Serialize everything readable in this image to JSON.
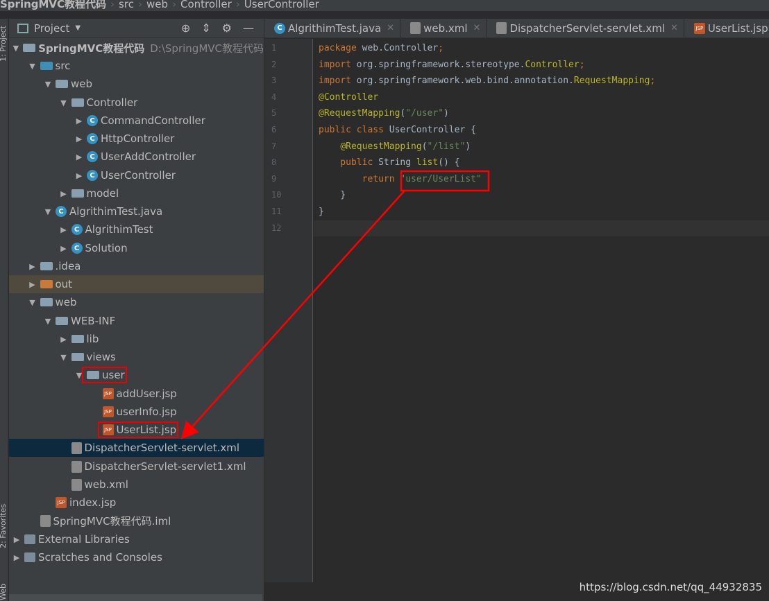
{
  "breadcrumb": [
    "SpringMVC教程代码",
    "src",
    "web",
    "Controller",
    "UserController"
  ],
  "side_stripe": {
    "project": "1: Project",
    "favorites": "2: Favorites",
    "web": "Web"
  },
  "panel": {
    "title": "Project",
    "icons": [
      "locate-icon",
      "collapse-all-icon",
      "gear-icon",
      "minimize-icon"
    ]
  },
  "tree": [
    {
      "label": "SpringMVC教程代码",
      "extra": "D:\\SpringMVC教程代码",
      "level": 0,
      "state": "open",
      "icon": "module",
      "bold": true
    },
    {
      "label": "src",
      "level": 1,
      "state": "open",
      "icon": "src"
    },
    {
      "label": "web",
      "level": 2,
      "state": "open",
      "icon": "folder"
    },
    {
      "label": "Controller",
      "level": 3,
      "state": "open",
      "icon": "folder"
    },
    {
      "label": "CommandController",
      "level": 4,
      "state": "closed",
      "icon": "class"
    },
    {
      "label": "HttpController",
      "level": 4,
      "state": "closed",
      "icon": "class"
    },
    {
      "label": "UserAddController",
      "level": 4,
      "state": "closed",
      "icon": "class"
    },
    {
      "label": "UserController",
      "level": 4,
      "state": "closed",
      "icon": "class"
    },
    {
      "label": "model",
      "level": 3,
      "state": "closed",
      "icon": "folder"
    },
    {
      "label": "AlgrithimTest.java",
      "level": 2,
      "state": "open",
      "icon": "class"
    },
    {
      "label": "AlgrithimTest",
      "level": 3,
      "state": "closed",
      "icon": "class"
    },
    {
      "label": "Solution",
      "level": 3,
      "state": "closed",
      "icon": "class"
    },
    {
      "label": ".idea",
      "level": 1,
      "state": "closed",
      "icon": "folder"
    },
    {
      "label": "out",
      "level": 1,
      "state": "closed",
      "icon": "out"
    },
    {
      "label": "web",
      "level": 1,
      "state": "open",
      "icon": "folder"
    },
    {
      "label": "WEB-INF",
      "level": 2,
      "state": "open",
      "icon": "folder"
    },
    {
      "label": "lib",
      "level": 3,
      "state": "closed",
      "icon": "folder"
    },
    {
      "label": "views",
      "level": 3,
      "state": "open",
      "icon": "folder"
    },
    {
      "label": "user",
      "level": 4,
      "state": "open",
      "icon": "folder",
      "highlight": true
    },
    {
      "label": "addUser.jsp",
      "level": 5,
      "state": "leaf",
      "icon": "jsp"
    },
    {
      "label": "userInfo.jsp",
      "level": 5,
      "state": "leaf",
      "icon": "jsp"
    },
    {
      "label": "UserList.jsp",
      "level": 5,
      "state": "leaf",
      "icon": "jsp",
      "highlight": true
    },
    {
      "label": "DispatcherServlet-servlet.xml",
      "level": 3,
      "state": "leaf",
      "icon": "xml",
      "selected": true
    },
    {
      "label": "DispatcherServlet-servlet1.xml",
      "level": 3,
      "state": "leaf",
      "icon": "xml"
    },
    {
      "label": "web.xml",
      "level": 3,
      "state": "leaf",
      "icon": "xml"
    },
    {
      "label": "index.jsp",
      "level": 2,
      "state": "leaf",
      "icon": "jsp"
    },
    {
      "label": "SpringMVC教程代码.iml",
      "level": 1,
      "state": "leaf",
      "icon": "iml"
    },
    {
      "label": "External Libraries",
      "level": 0,
      "state": "closed",
      "icon": "lib"
    },
    {
      "label": "Scratches and Consoles",
      "level": 0,
      "state": "closed",
      "icon": "scratch"
    }
  ],
  "tabs": [
    {
      "label": "AlgrithimTest.java",
      "icon": "class"
    },
    {
      "label": "web.xml",
      "icon": "xml"
    },
    {
      "label": "DispatcherServlet-servlet.xml",
      "icon": "xml"
    },
    {
      "label": "UserList.jsp",
      "icon": "jsp"
    }
  ],
  "code": [
    [
      [
        "kw",
        "package "
      ],
      [
        "pl",
        "web.Controller"
      ],
      [
        "kw",
        ";"
      ]
    ],
    [
      [
        "kw",
        "import "
      ],
      [
        "pl",
        "org.springframework.stereotype."
      ],
      [
        "an",
        "Controller"
      ],
      [
        "kw",
        ";"
      ]
    ],
    [
      [
        "kw",
        "import "
      ],
      [
        "pl",
        "org.springframework.web.bind.annotation."
      ],
      [
        "an",
        "RequestMapping"
      ],
      [
        "kw",
        ";"
      ]
    ],
    [
      [
        "an",
        "@Controller"
      ]
    ],
    [
      [
        "an",
        "@RequestMapping"
      ],
      [
        "pl",
        "("
      ],
      [
        "str",
        "\"/user\""
      ],
      [
        "pl",
        ")"
      ]
    ],
    [
      [
        "kw",
        "public class "
      ],
      [
        "pl",
        "UserController {"
      ]
    ],
    [
      [
        "pl",
        "    "
      ],
      [
        "an",
        "@RequestMapping"
      ],
      [
        "pl",
        "("
      ],
      [
        "str",
        "\"/list\""
      ],
      [
        "pl",
        ")"
      ]
    ],
    [
      [
        "kw",
        "    public "
      ],
      [
        "pl",
        "String "
      ],
      [
        "an",
        "list"
      ],
      [
        "pl",
        "() {"
      ]
    ],
    [
      [
        "kw",
        "        return "
      ],
      [
        "str",
        "\"user/UserList\""
      ]
    ],
    [
      [
        "pl",
        "    }"
      ]
    ],
    [
      [
        "pl",
        "}"
      ]
    ],
    [
      [
        "pl",
        ""
      ]
    ]
  ],
  "watermark": "https://blog.csdn.net/qq_44932835",
  "colors": {
    "annotation_box": "#ff0000",
    "selection": "#0d293e"
  }
}
